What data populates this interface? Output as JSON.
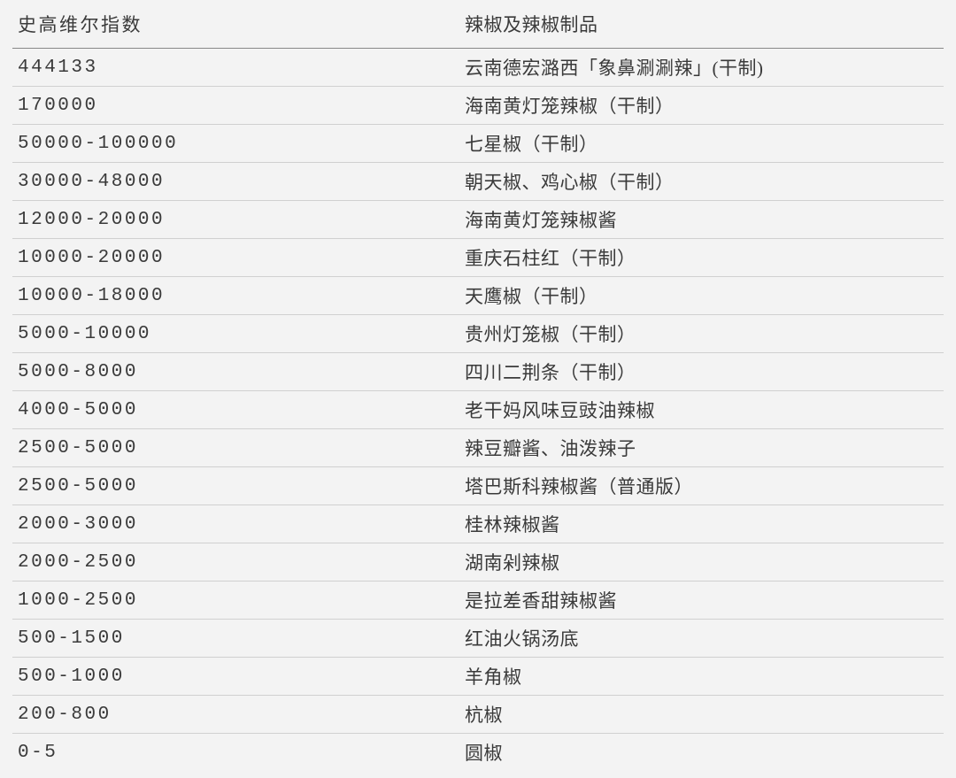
{
  "headers": {
    "index": "史高维尔指数",
    "name": "辣椒及辣椒制品"
  },
  "rows": [
    {
      "index": "444133",
      "name": "云南德宏潞西「象鼻涮涮辣」(干制)"
    },
    {
      "index": "170000",
      "name": "海南黄灯笼辣椒（干制）"
    },
    {
      "index": "50000-100000",
      "name": "七星椒（干制）"
    },
    {
      "index": "30000-48000",
      "name": "朝天椒、鸡心椒（干制）"
    },
    {
      "index": "12000-20000",
      "name": "海南黄灯笼辣椒酱"
    },
    {
      "index": "10000-20000",
      "name": "重庆石柱红（干制）"
    },
    {
      "index": "10000-18000",
      "name": "天鹰椒（干制）"
    },
    {
      "index": "5000-10000",
      "name": "贵州灯笼椒（干制）"
    },
    {
      "index": "5000-8000",
      "name": "四川二荆条（干制）"
    },
    {
      "index": "4000-5000",
      "name": "老干妈风味豆豉油辣椒"
    },
    {
      "index": "2500-5000",
      "name": "辣豆瓣酱、油泼辣子"
    },
    {
      "index": "2500-5000",
      "name": "塔巴斯科辣椒酱（普通版）"
    },
    {
      "index": "2000-3000",
      "name": "桂林辣椒酱"
    },
    {
      "index": "2000-2500",
      "name": "湖南剁辣椒"
    },
    {
      "index": "1000-2500",
      "name": "是拉差香甜辣椒酱"
    },
    {
      "index": "500-1500",
      "name": "红油火锅汤底"
    },
    {
      "index": "500-1000",
      "name": "羊角椒"
    },
    {
      "index": "200-800",
      "name": "杭椒"
    },
    {
      "index": "0-5",
      "name": "圆椒"
    }
  ]
}
